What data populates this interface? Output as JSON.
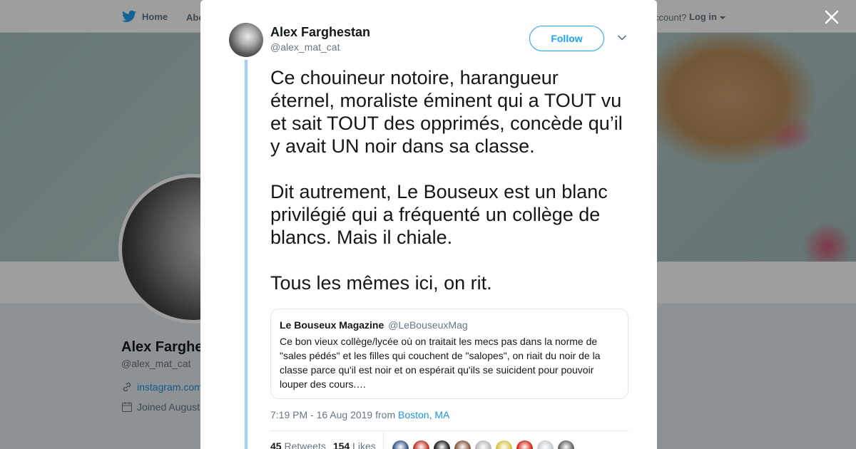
{
  "nav": {
    "home_label": "Home",
    "about_label": "Abo",
    "account_prompt": "ccount?",
    "login_label": "Log in"
  },
  "profile": {
    "name": "Alex Farghe",
    "handle": "@alex_mat_cat",
    "link": "instagram.com",
    "joined": "Joined August"
  },
  "tweet": {
    "author_name": "Alex Farghestan",
    "author_handle": "@alex_mat_cat",
    "follow_label": "Follow",
    "text": "Ce chouineur notoire, harangueur éternel, moraliste éminent qui a TOUT vu et sait TOUT des opprimés, concède qu’il y avait UN noir dans sa classe.\n\nDit autrement, Le Bouseux est un blanc privilégié qui a fréquenté un collège de blancs. Mais il chiale.\n\nTous les mêmes ici, on rit.",
    "quote": {
      "name": "Le Bouseux Magazine",
      "handle": "@LeBouseuxMag",
      "text": "Ce bon vieux collège/lycée où on traitait les mecs pas dans la norme de \"sales pédés\" et les filles qui couchent de \"salopes\", on riait du noir de la classe parce qu'il est noir et on espérait qu'ils se suicident pour pouvoir louper des cours.…"
    },
    "timestamp": "7:19 PM - 16 Aug 2019 from",
    "location": "Boston, MA",
    "retweets_count": "45",
    "retweets_label": "Retweets",
    "likes_count": "154",
    "likes_label": "Likes",
    "liker_colors": [
      "#3b5b8c",
      "#c0392b",
      "#222222",
      "#8a5a44",
      "#b9b9b9",
      "#d8c34a",
      "#d42a1a",
      "#c7cdd3",
      "#666666"
    ]
  },
  "colors": {
    "accent": "#1da1f2",
    "link": "#1b95e0",
    "thread_line": "#9fd2f8"
  },
  "icons": [
    "twitter-bird-icon",
    "caret-down-icon",
    "link-icon",
    "calendar-icon",
    "close-icon",
    "chevron-down-icon"
  ]
}
